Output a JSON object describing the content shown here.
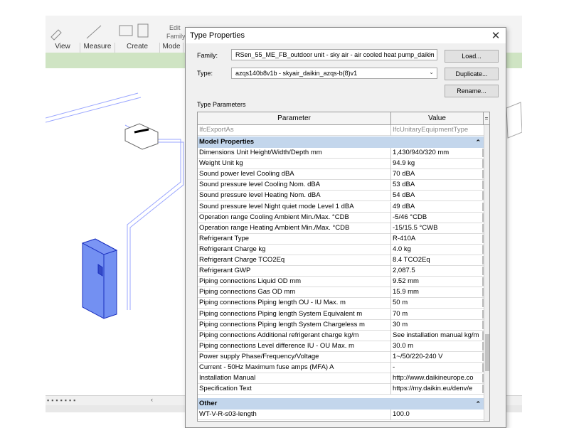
{
  "ribbon": {
    "panels": [
      "View",
      "Measure",
      "Create",
      "Mode"
    ],
    "tool_labels": [
      "Edit",
      "Family"
    ]
  },
  "dialog": {
    "title": "Type Properties",
    "family_label": "Family:",
    "family_value": "RSen_55_ME_FB_outdoor unit - sky air - air cooled heat pump_daikin",
    "type_label": "Type:",
    "type_value": "azqs140b8v1b - skyair_daikin_azqs-b(8)v1",
    "load_button": "Load...",
    "duplicate_button": "Duplicate...",
    "rename_button": "Rename...",
    "type_parameters_label": "Type Parameters",
    "table": {
      "col_parameter": "Parameter",
      "col_value": "Value",
      "top_row": {
        "parameter": "IfcExportAs",
        "value": "IfcUnitaryEquipmentType"
      },
      "group_model": "Model Properties",
      "rows": [
        {
          "parameter": "Dimensions Unit Height/Width/Depth mm",
          "value": "1,430/940/320 mm"
        },
        {
          "parameter": "Weight Unit kg",
          "value": "94.9 kg"
        },
        {
          "parameter": "Sound power level Cooling dBA",
          "value": "70 dBA"
        },
        {
          "parameter": "Sound pressure level Cooling Nom. dBA",
          "value": "53 dBA"
        },
        {
          "parameter": "Sound pressure level Heating Nom. dBA",
          "value": "54 dBA"
        },
        {
          "parameter": "Sound pressure level Night quiet mode Level 1 dBA",
          "value": "49 dBA"
        },
        {
          "parameter": "Operation range Cooling Ambient Min./Max. °CDB",
          "value": "-5/46 °CDB"
        },
        {
          "parameter": "Operation range Heating Ambient Min./Max. °CDB",
          "value": "-15/15.5 °CWB"
        },
        {
          "parameter": "Refrigerant Type",
          "value": "R-410A"
        },
        {
          "parameter": "Refrigerant Charge kg",
          "value": "4.0 kg"
        },
        {
          "parameter": "Refrigerant Charge TCO2Eq",
          "value": "8.4 TCO2Eq"
        },
        {
          "parameter": "Refrigerant GWP",
          "value": "2,087.5"
        },
        {
          "parameter": "Piping connections Liquid OD mm",
          "value": "9.52 mm"
        },
        {
          "parameter": "Piping connections Gas OD mm",
          "value": "15.9 mm"
        },
        {
          "parameter": "Piping connections Piping length OU - IU Max. m",
          "value": "50 m"
        },
        {
          "parameter": "Piping connections Piping length System Equivalent m",
          "value": "70 m"
        },
        {
          "parameter": "Piping connections Piping length System Chargeless m",
          "value": "30 m"
        },
        {
          "parameter": "Piping connections Additional refrigerant charge kg/m",
          "value": "See installation manual kg/m"
        },
        {
          "parameter": "Piping connections Level difference IU - OU Max. m",
          "value": "30.0 m"
        },
        {
          "parameter": "Power supply Phase/Frequency/Voltage",
          "value": "1~/50/220-240 V"
        },
        {
          "parameter": "Current - 50Hz Maximum fuse amps (MFA) A",
          "value": "-"
        },
        {
          "parameter": "Installation Manual",
          "value": "http://www.daikineurope.co"
        },
        {
          "parameter": "Specification Text",
          "value": "https://my.daikin.eu/denv/e"
        }
      ],
      "group_other": "Other",
      "partial_row": {
        "parameter": "WT-V-R-s03-length",
        "value": "100.0"
      }
    }
  }
}
